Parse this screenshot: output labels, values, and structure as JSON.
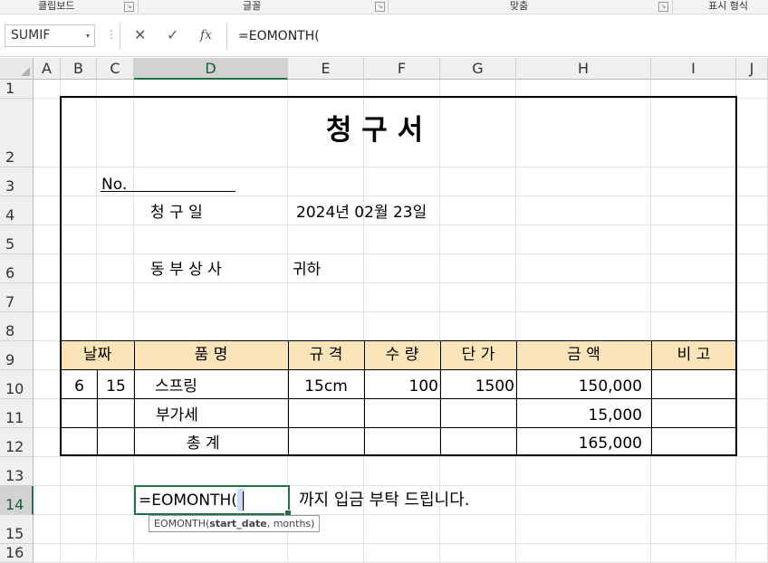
{
  "ribbon": {
    "groups": [
      "클립보드",
      "글꼴",
      "맞춤",
      "표시 형식"
    ],
    "launcher_glyph": "↘"
  },
  "formula_bar": {
    "name_box": "SUMIF",
    "dropdown_glyph": "▾",
    "menu_glyph": "⋮",
    "cancel_glyph": "✕",
    "enter_glyph": "✓",
    "fx_glyph": "fx",
    "formula": "=EOMONTH("
  },
  "grid": {
    "columns": [
      "A",
      "B",
      "C",
      "D",
      "E",
      "F",
      "G",
      "H",
      "I",
      "J"
    ],
    "rows": [
      "1",
      "2",
      "3",
      "4",
      "5",
      "6",
      "7",
      "8",
      "9",
      "10",
      "11",
      "12",
      "13",
      "14",
      "15",
      "16"
    ],
    "selected_column": "D",
    "selected_row": "14"
  },
  "invoice": {
    "title": "청   구   서",
    "number_label": "No.",
    "date_label": "청   구   일",
    "date_value": "2024년 02월 23일",
    "recipient": "동 부 상 사",
    "honorific": "귀하",
    "table": {
      "headers": [
        "날짜",
        "품         명",
        "규  격",
        "수  량",
        "단  가",
        "금        액",
        "비    고"
      ],
      "rows": [
        {
          "month": "6",
          "day": "15",
          "item": "스프링",
          "spec": "15cm",
          "qty": "100",
          "price": "1500",
          "amount": "150,000",
          "note": ""
        },
        {
          "month": "",
          "day": "",
          "item": "부가세",
          "spec": "",
          "qty": "",
          "price": "",
          "amount": "15,000",
          "note": ""
        },
        {
          "month": "",
          "day": "",
          "item": "총    계",
          "spec": "",
          "qty": "",
          "price": "",
          "amount": "165,000",
          "note": ""
        }
      ]
    },
    "edit_cell_text": "=EOMONTH(",
    "payment_text": "까지  입금  부탁  드립니다.",
    "tooltip": {
      "fn": "EOMONTH(",
      "arg1": "start_date",
      "rest": ", months)"
    }
  }
}
